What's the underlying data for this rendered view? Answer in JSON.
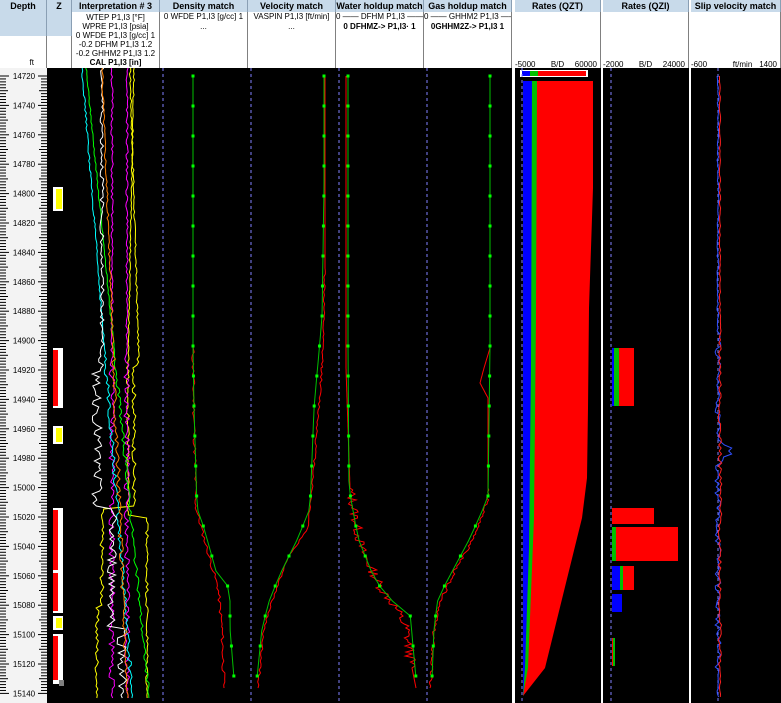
{
  "depth": {
    "title": "Depth",
    "unit": "ft",
    "labels": [
      "14720",
      "14740",
      "14760",
      "14780",
      "14800",
      "14820",
      "14840",
      "14860",
      "14880",
      "14900",
      "14920",
      "14940",
      "14960",
      "14980",
      "15000",
      "15020",
      "15040",
      "15060",
      "15080",
      "15100",
      "15120",
      "15140"
    ]
  },
  "zone": {
    "title": "Z"
  },
  "interp": {
    "title": "Interpretation # 3",
    "lines": [
      {
        "text": "WTEP  P1,I3 [°F]",
        "bold": false
      },
      {
        "text": "WPRE  P1,I3 [psia]",
        "bold": false
      },
      {
        "text": "0 WFDE  P1,I3 [g/cc] 1",
        "bold": false
      },
      {
        "text": "-0.2  DFHM  P1,I3    1.2",
        "bold": false
      },
      {
        "text": "-0.2 GHHM2  P1,I3   1.2",
        "bold": false
      },
      {
        "text": "CAL  P1,I3 [in]",
        "bold": true
      }
    ]
  },
  "density": {
    "title": "Density match",
    "line1": "0 WFDE  P1,I3 [g/cc]  1",
    "line2": "..."
  },
  "velocity": {
    "title": "Velocity match",
    "line1": "VASPIN  P1,I3 [ft/min]",
    "line2": "..."
  },
  "water": {
    "title": "Water holdup match",
    "line1": "0 —— DFHM  P1,I3 —— 1",
    "line2": "0 DFHMZ->  P1,I3· 1"
  },
  "gas": {
    "title": "Gas holdup match",
    "line1": "0 —— GHHM2  P1,I3 —— 1",
    "line2": "0GHHM2Z->  P1,I3 1"
  },
  "rates_qzt": {
    "title": "Rates (QZT)",
    "min": "-5000",
    "unit": "B/D",
    "max": "60000"
  },
  "rates_qzi": {
    "title": "Rates (QZI)",
    "min": "-2000",
    "unit": "B/D",
    "max": "24000"
  },
  "slip": {
    "title": "Slip velocity match",
    "min": "-600",
    "unit": "ft/min",
    "max": "1400"
  },
  "colors": {
    "header_bg": "#c8daea",
    "track_bg": "#000000",
    "water": "#0000ff",
    "oil": "#00c000",
    "gas": "#ff0000"
  }
}
